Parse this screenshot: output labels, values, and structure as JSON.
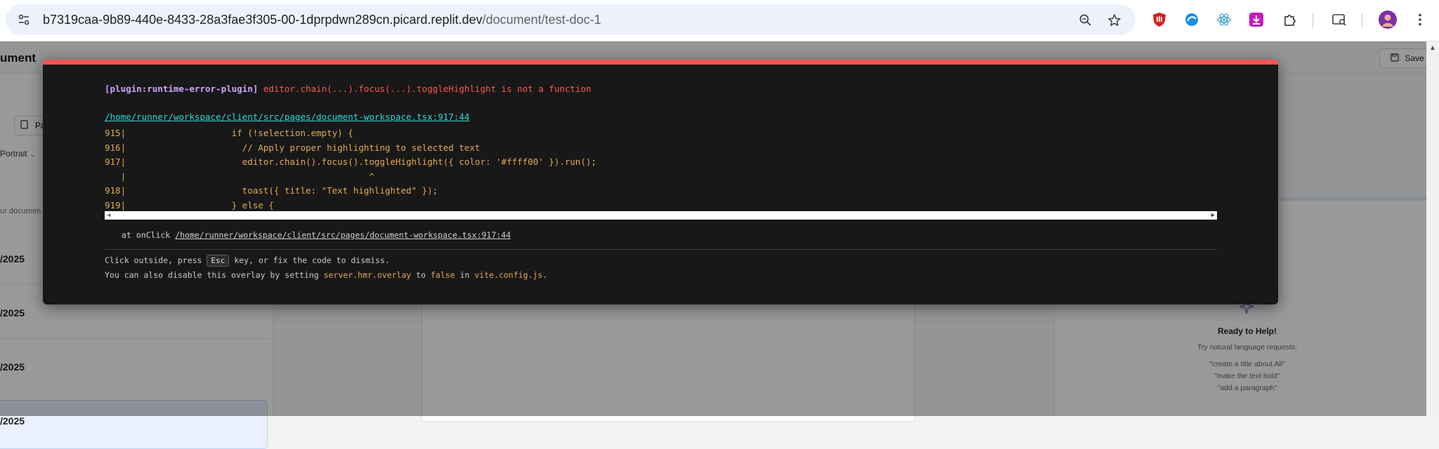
{
  "browser": {
    "url_host": "b7319caa-9b89-440e-8433-28a3fae3f305-00-1dprpdwn289cn.picard.replit.dev",
    "url_path": "/document/test-doc-1",
    "icons": [
      "site-settings-icon",
      "zoom-icon",
      "bookmark-star-icon",
      "ublock-extension-icon",
      "sky-extension-icon",
      "react-devtools-extension-icon",
      "download-extension-icon",
      "extensions-puzzle-icon",
      "search-tabs-icon",
      "profile-avatar-icon",
      "more-menu-icon"
    ]
  },
  "app": {
    "title": "ument",
    "save_label": "Save",
    "pa_label": "Pa",
    "portrait_label": "Portrait",
    "hint_text": "ur documen",
    "documents": [
      {
        "date": "/2025"
      },
      {
        "date": "/2025"
      },
      {
        "date": "/2025"
      },
      {
        "date": "/2025"
      }
    ],
    "assistant": {
      "heading": "Ready to Help!",
      "subheading": "Try natural language requests:",
      "examples": [
        "\"create a title about Ali\"",
        "\"make the text bold\"",
        "\"add a paragraph\""
      ]
    }
  },
  "overlay": {
    "plugin": "[plugin:runtime-error-plugin]",
    "message": "editor.chain(...).focus(...).toggleHighlight is not a function",
    "file": "/home/runner/workspace/client/src/pages/document-workspace.tsx:917:44",
    "frame_lines": [
      "915|                    if (!selection.empty) {",
      "916|                      // Apply proper highlighting to selected text",
      "917|                      editor.chain().focus().toggleHighlight({ color: '#ffff00' }).run();",
      "   |                                              ^",
      "918|                      toast({ title: \"Text highlighted\" });",
      "919|                    } else {"
    ],
    "stack_prefix": "at onClick",
    "stack_file": "/home/runner/workspace/client/src/pages/document-workspace.tsx:917:44",
    "tip1_before": "Click outside, press ",
    "tip1_key": "Esc",
    "tip1_after": " key, or fix the code to dismiss.",
    "tip2_a": "You can also disable this overlay by setting ",
    "tip2_code1": "server.hmr.overlay",
    "tip2_b": " to ",
    "tip2_code2": "false",
    "tip2_c": " in ",
    "tip2_code3": "vite.config.js",
    "tip2_d": "."
  },
  "colors": {
    "error_red": "#ff5555",
    "overlay_bg": "#181818",
    "link_cyan": "#2dd9da",
    "code_yellow": "#e2aa53",
    "plugin_purple": "#cfa3ff"
  }
}
